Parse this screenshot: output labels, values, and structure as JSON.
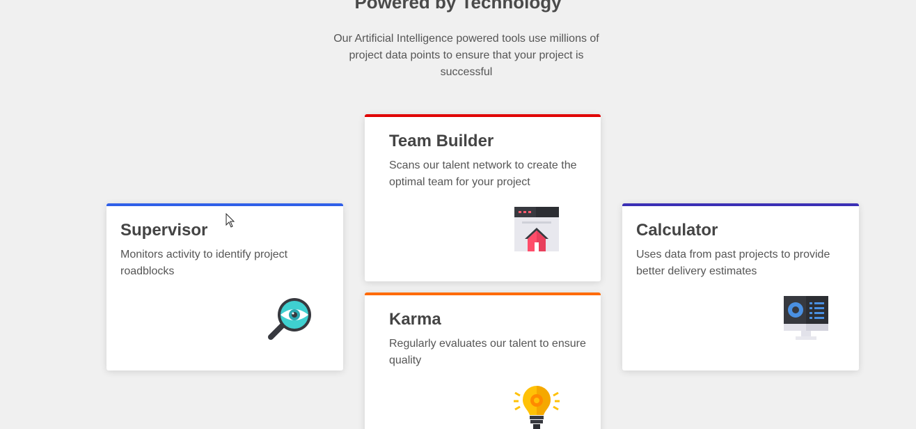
{
  "section": {
    "title": "Powered by Technology",
    "subtitle": "Our Artificial Intelligence powered tools use millions of project data points to ensure that your project is successful"
  },
  "cards": {
    "team_builder": {
      "title": "Team Builder",
      "description": "Scans our talent network to create the optimal team for your project",
      "accent": "#e00000",
      "icon": "browser-house-icon"
    },
    "supervisor": {
      "title": "Supervisor",
      "description": "Monitors activity to identify project roadblocks",
      "accent": "#2f5fe8",
      "icon": "magnifier-eye-icon"
    },
    "calculator": {
      "title": "Calculator",
      "description": "Uses data from past projects to provide better delivery estimates",
      "accent": "#3b2fb5",
      "icon": "monitor-dashboard-icon"
    },
    "karma": {
      "title": "Karma",
      "description": "Regularly evaluates our talent to ensure quality",
      "accent": "#ff6a00",
      "icon": "lightbulb-gear-icon"
    }
  }
}
